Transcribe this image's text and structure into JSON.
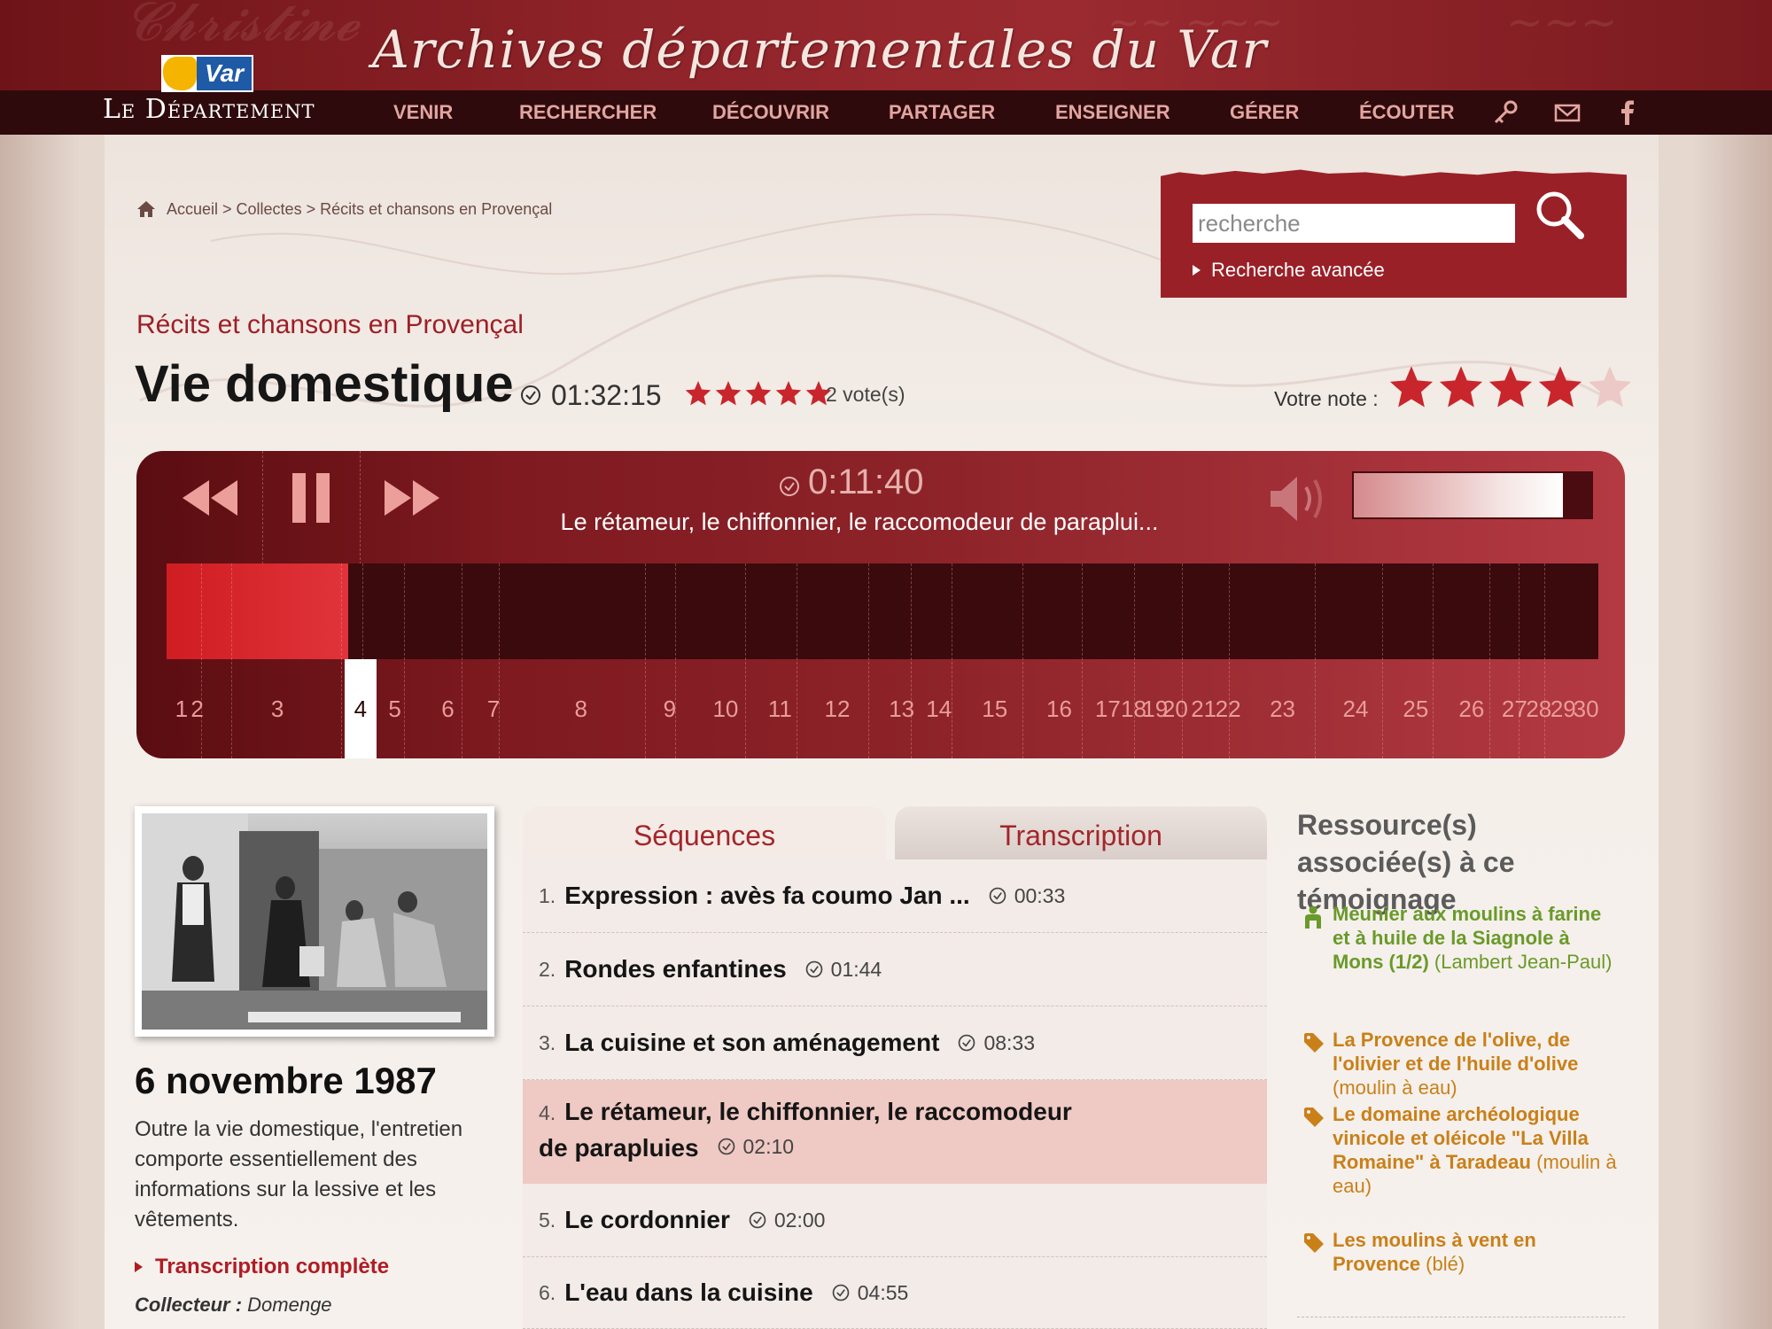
{
  "header": {
    "site_title": "Archives départementales du Var",
    "logo_var": "Var",
    "logo_text": "Le Département",
    "nav": [
      "VENIR",
      "RECHERCHER",
      "DÉCOUVRIR",
      "PARTAGER",
      "ENSEIGNER",
      "GÉRER",
      "ÉCOUTER"
    ],
    "nav_icons": [
      "key-icon",
      "mail-icon",
      "facebook-icon"
    ]
  },
  "breadcrumb": {
    "home": "Accueil",
    "path": "Accueil > Collectes > Récits et chansons en Provençal"
  },
  "search": {
    "placeholder": "recherche",
    "advanced": "Recherche avancée"
  },
  "record": {
    "collection": "Récits et chansons en Provençal",
    "title": "Vie domestique",
    "duration": "01:32:15",
    "rating": 5,
    "votes": "2 vote(s)",
    "your_note_label": "Votre note :",
    "your_note": 4,
    "date": "6 novembre 1987",
    "description": "Outre la vie domestique, l'entretien comporte essentiellement des informations sur la lessive et les vêtements.",
    "full_transcript": "Transcription complète",
    "collector_label": "Collecteur :",
    "collector_name": "Domenge"
  },
  "player": {
    "current_time": "0:11:40",
    "current_track": "Le rétameur, le chiffonnier, le raccomodeur de paraplui...",
    "progress": 0.127,
    "volume": 0.88,
    "active_sequence": 4,
    "markers": [
      {
        "n": "1",
        "x": 0.003
      },
      {
        "n": "2",
        "x": 0.014
      },
      {
        "n": "3",
        "x": 0.07
      },
      {
        "n": "4",
        "x": 0.128
      },
      {
        "n": "5",
        "x": 0.152
      },
      {
        "n": "6",
        "x": 0.189
      },
      {
        "n": "7",
        "x": 0.221
      },
      {
        "n": "8",
        "x": 0.282
      },
      {
        "n": "9",
        "x": 0.344
      },
      {
        "n": "10",
        "x": 0.383
      },
      {
        "n": "11",
        "x": 0.421
      },
      {
        "n": "12",
        "x": 0.461
      },
      {
        "n": "13",
        "x": 0.506
      },
      {
        "n": "14",
        "x": 0.532
      },
      {
        "n": "15",
        "x": 0.571
      },
      {
        "n": "16",
        "x": 0.616
      },
      {
        "n": "17",
        "x": 0.65
      },
      {
        "n": "18",
        "x": 0.668
      },
      {
        "n": "19",
        "x": 0.683
      },
      {
        "n": "20",
        "x": 0.697
      },
      {
        "n": "21",
        "x": 0.717
      },
      {
        "n": "22",
        "x": 0.734
      },
      {
        "n": "23",
        "x": 0.772
      },
      {
        "n": "24",
        "x": 0.823
      },
      {
        "n": "25",
        "x": 0.865
      },
      {
        "n": "26",
        "x": 0.904
      },
      {
        "n": "27",
        "x": 0.934
      },
      {
        "n": "28",
        "x": 0.951
      },
      {
        "n": "29",
        "x": 0.968
      },
      {
        "n": "30",
        "x": 0.984
      }
    ],
    "major_ticks": [
      0.024,
      0.045,
      0.122,
      0.137,
      0.166,
      0.206,
      0.232,
      0.334,
      0.355,
      0.404,
      0.44,
      0.49,
      0.52,
      0.548,
      0.598,
      0.639,
      0.676,
      0.709,
      0.742,
      0.802,
      0.849,
      0.884,
      0.924,
      0.944,
      0.962
    ]
  },
  "tabs": {
    "sequences": "Séquences",
    "transcription": "Transcription"
  },
  "sequences": [
    {
      "num": "1.",
      "title": "Expression : avès fa coumo Jan ...",
      "duration": "00:33"
    },
    {
      "num": "2.",
      "title": "Rondes enfantines",
      "duration": "01:44"
    },
    {
      "num": "3.",
      "title": "La cuisine et son aménagement",
      "duration": "08:33"
    },
    {
      "num": "4.",
      "title": "Le rétameur, le chiffonnier, le raccomodeur de parapluies",
      "duration": "02:10"
    },
    {
      "num": "5.",
      "title": "Le cordonnier",
      "duration": "02:00"
    },
    {
      "num": "6.",
      "title": "L'eau dans la cuisine",
      "duration": "04:55"
    }
  ],
  "resources": {
    "heading": "Ressource(s) associée(s) à ce témoignage",
    "items": [
      {
        "icon": "person-icon",
        "link": "Meunier aux moulins à farine et à huile de la Siagnole à Mons (1/2)",
        "tail": " (Lambert Jean-Paul)",
        "color": "#6a9a2a"
      },
      {
        "icon": "tag-icon",
        "link": "La Provence de l'olive, de l'olivier et de l'huile d'olive",
        "tail": " (moulin à eau)",
        "color": "#c98019"
      },
      {
        "icon": "tag-icon",
        "link": "Le domaine archéologique vinicole et oléicole \"La Villa Romaine\" à Taradeau",
        "tail": " (moulin à eau)",
        "color": "#c98019"
      },
      {
        "icon": "tag-icon",
        "link": "Les moulins à vent en Provence",
        "tail": " (blé)",
        "color": "#c98019"
      }
    ]
  },
  "colors": {
    "brand_red": "#9a2028",
    "accent_red": "#cf1d22",
    "link_green": "#6a9a2a",
    "link_orange": "#c98019"
  }
}
